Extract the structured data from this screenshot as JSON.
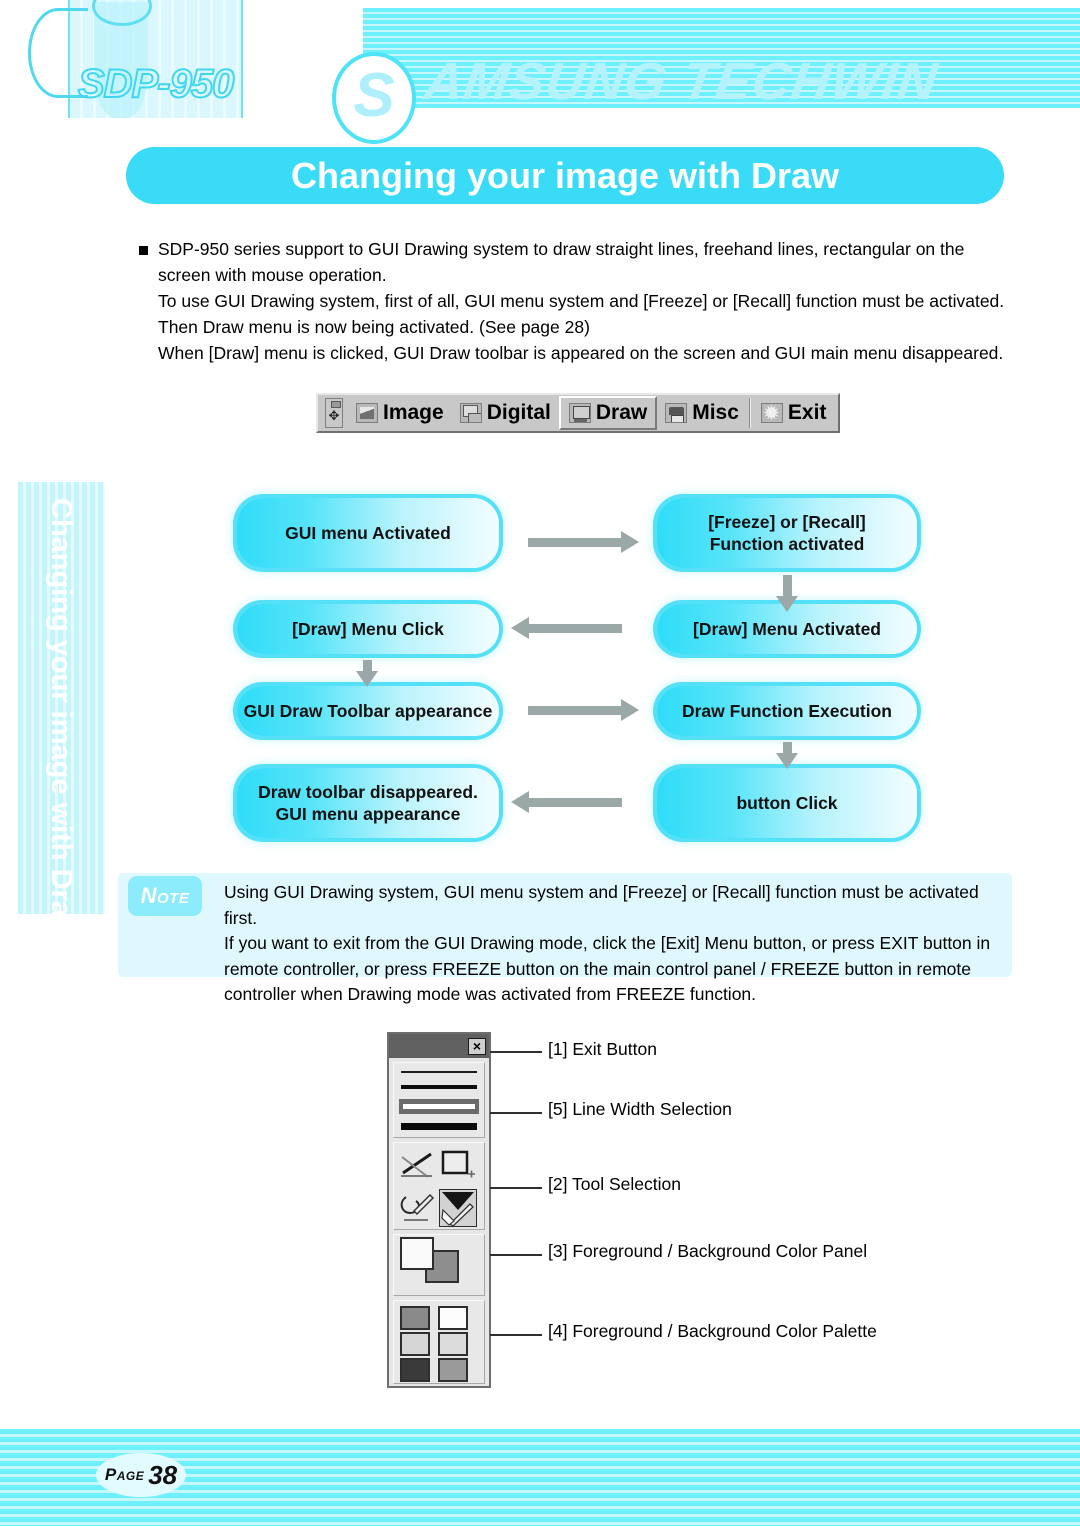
{
  "header": {
    "product_model": "SDP-950",
    "brand_initial": "S",
    "brand_rest": "AMSUNG TECHWIN",
    "page_title": "Changing your image with Draw"
  },
  "side_tab": {
    "label": "Changing your image with Draw"
  },
  "intro": {
    "line1": "SDP-950 series support to GUI Drawing system to draw straight lines, freehand lines, rectangular on the",
    "line2": "screen with mouse operation.",
    "line3": "To use GUI Drawing system, first of all, GUI menu system and [Freeze] or [Recall] function must be activated.",
    "line4": "Then Draw menu is now being activated. (See page 28)",
    "line5": "When [Draw] menu is clicked, GUI Draw toolbar is appeared on the screen and GUI main menu disappeared."
  },
  "menubar": {
    "grip_icon": "move-grip-icon",
    "items": [
      {
        "label": "Image",
        "icon": "image-icon",
        "selected": false
      },
      {
        "label": "Digital",
        "icon": "digital-icon",
        "selected": false
      },
      {
        "label": "Draw",
        "icon": "draw-icon",
        "selected": true
      },
      {
        "label": "Misc",
        "icon": "misc-icon",
        "selected": false
      },
      {
        "label": "Exit",
        "icon": "exit-icon",
        "selected": false
      }
    ]
  },
  "flowchart": {
    "boxes": [
      {
        "id": "b1",
        "text": "GUI menu Activated"
      },
      {
        "id": "b2",
        "text": "[Freeze] or [Recall]\nFunction activated",
        "line1": "[Freeze] or [Recall]",
        "line2": "Function activated"
      },
      {
        "id": "b3",
        "text": "[Draw] Menu Click"
      },
      {
        "id": "b4",
        "text": "[Draw] Menu Activated"
      },
      {
        "id": "b5",
        "text": "GUI Draw Toolbar appearance"
      },
      {
        "id": "b6",
        "text": "Draw Function Execution"
      },
      {
        "id": "b7",
        "text": "Draw toolbar disappeared.\nGUI menu appearance",
        "line1": "Draw toolbar disappeared.",
        "line2": "GUI menu appearance"
      },
      {
        "id": "b8",
        "text": "button Click"
      }
    ],
    "arrow_color": "#9aa8a8",
    "box_accent": "#2fdcf8"
  },
  "note": {
    "badge": "Note",
    "line1": "Using GUI Drawing system, GUI menu system and [Freeze] or [Recall] function must be activated first.",
    "line2": "If you want to exit from the GUI Drawing mode, click the [Exit] Menu button, or press EXIT button in",
    "line3": "remote controller, or press FREEZE button on the main control panel / FREEZE button in remote",
    "line4": "controller when Drawing mode was activated from FREEZE function."
  },
  "toolbar_diagram": {
    "close_button_glyph": "×",
    "line_widths": [
      {
        "index": 1,
        "thickness_px": 2,
        "selected": false
      },
      {
        "index": 2,
        "thickness_px": 4,
        "selected": false
      },
      {
        "index": 3,
        "thickness_px": 5,
        "selected": true
      },
      {
        "index": 4,
        "thickness_px": 7,
        "selected": false
      }
    ],
    "tools": [
      {
        "name": "line-tool",
        "selected": false
      },
      {
        "name": "rectangle-tool",
        "selected": false
      },
      {
        "name": "freehand-tool",
        "selected": false
      },
      {
        "name": "fill-tool",
        "selected": true
      }
    ],
    "fg_color": "#fafafa",
    "bg_color": "#8e8e8e",
    "palette": [
      "#8a8a8a",
      "#fdfdfd",
      "#d6d6d6",
      "#dcdcdc",
      "#3a3a3a",
      "#9a9a9a"
    ],
    "callouts": [
      {
        "n": "[1]",
        "label": "[1] Exit Button"
      },
      {
        "n": "[5]",
        "label": "[5] Line Width Selection"
      },
      {
        "n": "[2]",
        "label": "[2] Tool Selection"
      },
      {
        "n": "[3]",
        "label": "[3] Foreground / Background Color Panel"
      },
      {
        "n": "[4]",
        "label": "[4] Foreground / Background Color Palette"
      }
    ]
  },
  "footer": {
    "page_word": "Page",
    "page_number": "38"
  }
}
